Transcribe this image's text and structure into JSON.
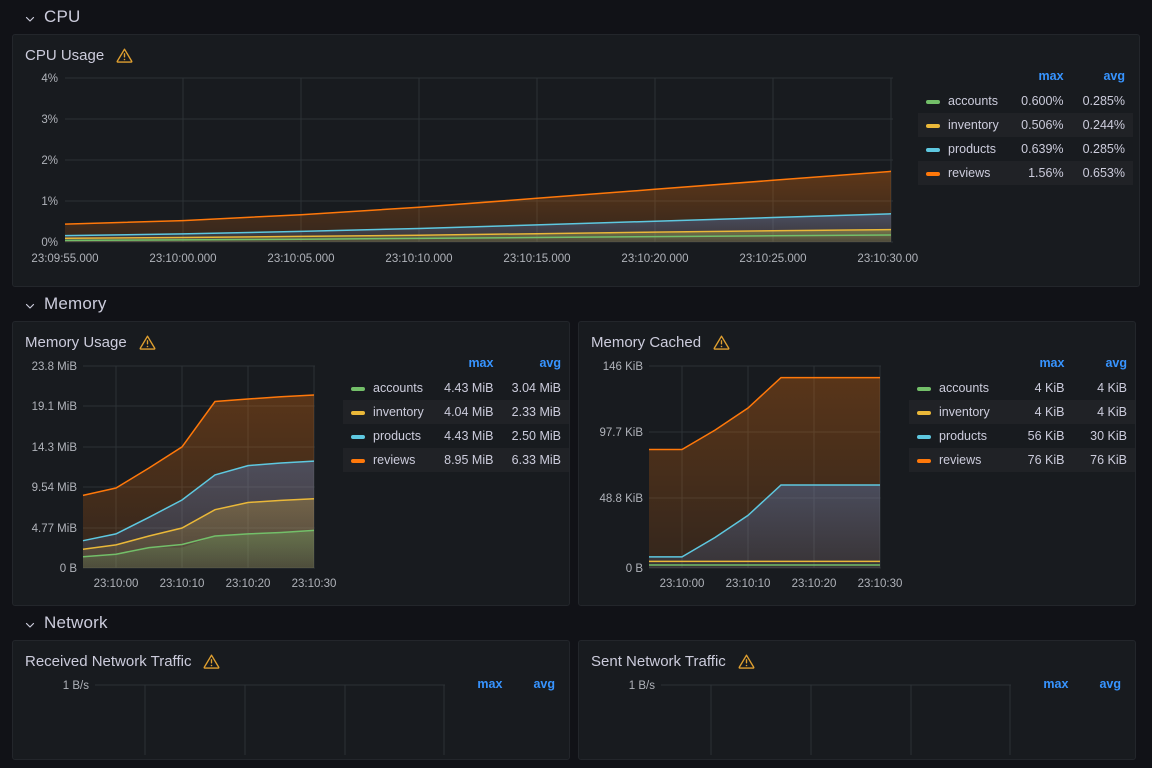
{
  "theme": {
    "page_bg": "#111217",
    "panel_bg": "#181b1f",
    "accent_blue": "#3794ff",
    "warn_color": "#e0a030",
    "text": "#ccccdc"
  },
  "series_colors": {
    "accounts": "#73bf69",
    "inventory": "#eab839",
    "products": "#5794f2",
    "reviews": "#ff780a"
  },
  "sections": [
    {
      "id": "cpu",
      "title": "CPU",
      "chevron": "chevron-down-icon"
    },
    {
      "id": "memory",
      "title": "Memory",
      "chevron": "chevron-down-icon"
    },
    {
      "id": "network",
      "title": "Network",
      "chevron": "chevron-down-icon"
    }
  ],
  "panels": {
    "cpu_usage": {
      "title": "CPU Usage",
      "alert_icon": "warning-triangle-icon",
      "legend_headers": {
        "max": "max",
        "avg": "avg"
      },
      "legend": [
        {
          "name": "accounts",
          "max": "0.600%",
          "avg": "0.285%",
          "color": "#73bf69"
        },
        {
          "name": "inventory",
          "max": "0.506%",
          "avg": "0.244%",
          "color": "#eab839"
        },
        {
          "name": "products",
          "max": "0.639%",
          "avg": "0.285%",
          "color": "#5794f2"
        },
        {
          "name": "reviews",
          "max": "1.56%",
          "avg": "0.653%",
          "color": "#ff780a"
        }
      ]
    },
    "memory_usage": {
      "title": "Memory Usage",
      "alert_icon": "warning-triangle-icon",
      "legend_headers": {
        "max": "max",
        "avg": "avg"
      },
      "legend": [
        {
          "name": "accounts",
          "max": "4.43 MiB",
          "avg": "3.04 MiB",
          "color": "#73bf69"
        },
        {
          "name": "inventory",
          "max": "4.04 MiB",
          "avg": "2.33 MiB",
          "color": "#eab839"
        },
        {
          "name": "products",
          "max": "4.43 MiB",
          "avg": "2.50 MiB",
          "color": "#5794f2"
        },
        {
          "name": "reviews",
          "max": "8.95 MiB",
          "avg": "6.33 MiB",
          "color": "#ff780a"
        }
      ]
    },
    "memory_cached": {
      "title": "Memory Cached",
      "alert_icon": "warning-triangle-icon",
      "legend_headers": {
        "max": "max",
        "avg": "avg"
      },
      "legend": [
        {
          "name": "accounts",
          "max": "4 KiB",
          "avg": "4 KiB",
          "color": "#73bf69"
        },
        {
          "name": "inventory",
          "max": "4 KiB",
          "avg": "4 KiB",
          "color": "#eab839"
        },
        {
          "name": "products",
          "max": "56 KiB",
          "avg": "30 KiB",
          "color": "#5794f2"
        },
        {
          "name": "reviews",
          "max": "76 KiB",
          "avg": "76 KiB",
          "color": "#ff780a"
        }
      ]
    },
    "received_network_traffic": {
      "title": "Received Network Traffic",
      "alert_icon": "warning-triangle-icon",
      "legend_headers": {
        "max": "max",
        "avg": "avg"
      },
      "legend": []
    },
    "sent_network_traffic": {
      "title": "Sent Network Traffic",
      "alert_icon": "warning-triangle-icon",
      "legend_headers": {
        "max": "max",
        "avg": "avg"
      },
      "legend": []
    }
  },
  "chart_data": [
    {
      "id": "cpu_usage",
      "type": "area",
      "title": "CPU Usage",
      "stacked": true,
      "xlabel": "",
      "ylabel": "",
      "x_ticks": [
        "23:09:55.000",
        "23:10:00.000",
        "23:10:05.000",
        "23:10:10.000",
        "23:10:15.000",
        "23:10:20.000",
        "23:10:25.000",
        "23:10:30.000"
      ],
      "y_ticks": [
        "0%",
        "1%",
        "2%",
        "3%",
        "4%"
      ],
      "ylim": [
        0,
        4
      ],
      "grid": true,
      "legend_position": "right",
      "x": [
        0,
        5,
        10,
        15,
        20,
        25,
        30,
        35
      ],
      "series": [
        {
          "name": "accounts",
          "values": [
            0.07,
            0.08,
            0.1,
            0.13,
            0.17,
            0.21,
            0.25,
            0.285
          ]
        },
        {
          "name": "inventory",
          "values": [
            0.06,
            0.07,
            0.09,
            0.12,
            0.15,
            0.19,
            0.22,
            0.244
          ]
        },
        {
          "name": "products",
          "values": [
            0.09,
            0.11,
            0.14,
            0.18,
            0.23,
            0.28,
            0.33,
            0.38
          ]
        },
        {
          "name": "reviews",
          "values": [
            0.28,
            0.36,
            0.5,
            0.68,
            0.9,
            1.12,
            1.34,
            1.56
          ]
        }
      ]
    },
    {
      "id": "memory_usage",
      "type": "area",
      "title": "Memory Usage",
      "stacked": true,
      "xlabel": "",
      "ylabel": "",
      "x_ticks": [
        "23:10:00",
        "23:10:10",
        "23:10:20",
        "23:10:30"
      ],
      "y_ticks": [
        "0 B",
        "4.77 MiB",
        "9.54 MiB",
        "14.3 MiB",
        "19.1 MiB",
        "23.8 MiB"
      ],
      "ylim": [
        0,
        23.8
      ],
      "grid": true,
      "legend_position": "right",
      "x": [
        0,
        5,
        10,
        15,
        20,
        25,
        30,
        35
      ],
      "series": [
        {
          "name": "accounts",
          "values": [
            1.4,
            1.8,
            2.5,
            3.2,
            3.8,
            4.1,
            4.3,
            4.43
          ]
        },
        {
          "name": "inventory",
          "values": [
            0.9,
            1.1,
            1.6,
            2.3,
            3.1,
            3.7,
            3.9,
            4.04
          ]
        },
        {
          "name": "products",
          "values": [
            1.0,
            1.3,
            2.2,
            3.3,
            4.1,
            4.35,
            4.4,
            4.43
          ]
        },
        {
          "name": "reviews",
          "values": [
            4.8,
            5.6,
            6.8,
            7.9,
            8.6,
            8.8,
            8.9,
            8.95
          ]
        }
      ]
    },
    {
      "id": "memory_cached",
      "type": "area",
      "title": "Memory Cached",
      "stacked": true,
      "xlabel": "",
      "ylabel": "",
      "x_ticks": [
        "23:10:00",
        "23:10:10",
        "23:10:20",
        "23:10:30"
      ],
      "y_ticks": [
        "0 B",
        "48.8 KiB",
        "97.7 KiB",
        "146 KiB"
      ],
      "ylim": [
        0,
        146
      ],
      "grid": true,
      "legend_position": "right",
      "x": [
        0,
        5,
        10,
        15,
        20,
        25,
        30,
        35
      ],
      "series": [
        {
          "name": "accounts",
          "values": [
            4,
            4,
            4,
            4,
            4,
            4,
            4,
            4
          ]
        },
        {
          "name": "inventory",
          "values": [
            4,
            4,
            4,
            4,
            4,
            4,
            4,
            4
          ]
        },
        {
          "name": "products",
          "values": [
            4,
            4,
            18,
            34,
            56,
            56,
            56,
            56
          ]
        },
        {
          "name": "reviews",
          "values": [
            76,
            76,
            76,
            76,
            76,
            76,
            76,
            76
          ]
        }
      ]
    },
    {
      "id": "received_network_traffic",
      "type": "area",
      "title": "Received Network Traffic",
      "stacked": true,
      "y_ticks": [
        "1 B/s"
      ],
      "x_ticks": [],
      "grid": true,
      "legend_position": "right",
      "series": []
    },
    {
      "id": "sent_network_traffic",
      "type": "area",
      "title": "Sent Network Traffic",
      "stacked": true,
      "y_ticks": [
        "1 B/s"
      ],
      "x_ticks": [],
      "grid": true,
      "legend_position": "right",
      "series": []
    }
  ]
}
